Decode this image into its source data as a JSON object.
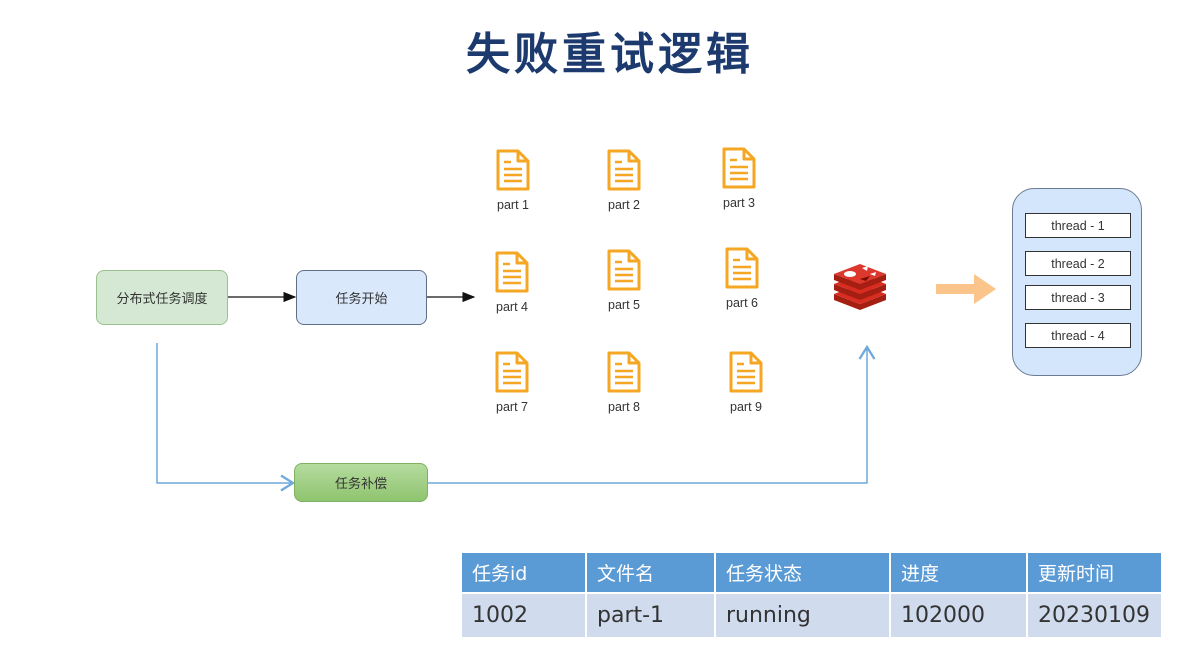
{
  "title": "失败重试逻辑",
  "nodes": {
    "scheduler": "分布式任务调度",
    "task_start": "任务开始",
    "compensation": "任务补偿"
  },
  "files": [
    {
      "label": "part 1"
    },
    {
      "label": "part 2"
    },
    {
      "label": "part 3"
    },
    {
      "label": "part 4"
    },
    {
      "label": "part 5"
    },
    {
      "label": "part 6"
    },
    {
      "label": "part 7"
    },
    {
      "label": "part 8"
    },
    {
      "label": "part 9"
    }
  ],
  "cache_icon": "redis-icon",
  "thread_pool": {
    "threads": [
      "thread - 1",
      "thread - 2",
      "thread - 3",
      "thread - 4"
    ]
  },
  "table": {
    "headers": [
      "任务id",
      "文件名",
      "任务状态",
      "进度",
      "更新时间"
    ],
    "rows": [
      [
        "1002",
        "part-1",
        "running",
        "102000",
        "20230109"
      ]
    ]
  },
  "colors": {
    "title": "#1c3a6e",
    "file_icon": "#f5a623",
    "table_header": "#5b9bd5",
    "table_row": "#d0dcee",
    "connector_blue": "#6fa8dc",
    "arrow_orange": "#fbc48a"
  }
}
